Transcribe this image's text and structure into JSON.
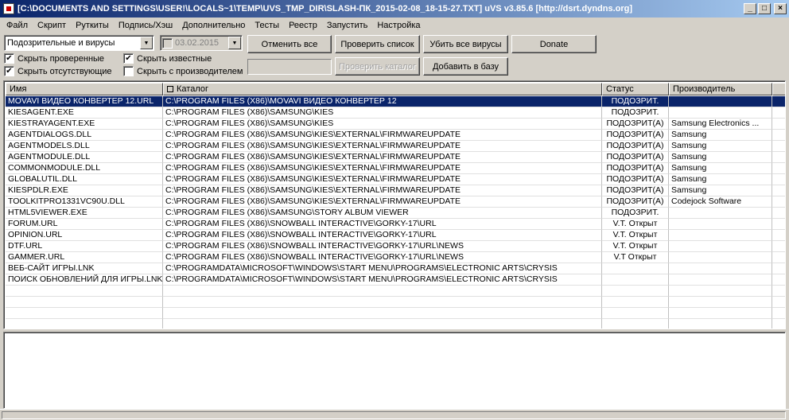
{
  "window": {
    "title": "[C:\\DOCUMENTS AND SETTINGS\\USER!\\LOCALS~1\\TEMP\\UVS_TMP_DIR\\SLASH-ПК_2015-02-08_18-15-27.TXT] uVS v3.85.6 [http://dsrt.dyndns.org]",
    "minimize": "_",
    "maximize": "□",
    "close": "×"
  },
  "menu": [
    "Файл",
    "Скрипт",
    "Руткиты",
    "Подпись/Хэш",
    "Дополнительно",
    "Тесты",
    "Реестр",
    "Запустить",
    "Настройка"
  ],
  "filter": {
    "selected": "Подозрительные и вирусы",
    "date": "03.02.2015"
  },
  "checks": {
    "hide_checked": {
      "label": "Скрыть проверенные",
      "checked": true
    },
    "hide_known": {
      "label": "Скрыть известные",
      "checked": true
    },
    "hide_missing": {
      "label": "Скрыть отсутствующие",
      "checked": true
    },
    "hide_with_vendor": {
      "label": "Скрыть с производителем",
      "checked": false
    }
  },
  "buttons": {
    "cancel_all": "Отменить все",
    "check_list": "Проверить список",
    "kill_all": "Убить все вирусы",
    "donate": "Donate",
    "check_dir": "Проверить каталог",
    "add_to_db": "Добавить в базу"
  },
  "columns": {
    "name": "Имя",
    "dir": "Каталог",
    "status": "Статус",
    "vendor": "Производитель"
  },
  "rows": [
    {
      "name": "MOVAVI ВИДЕО КОНВЕРТЕР 12.URL",
      "dir": "C:\\PROGRAM FILES (X86)\\MOVAVI ВИДЕО КОНВЕРТЕР 12",
      "status": "ПОДОЗРИТ.",
      "vendor": ""
    },
    {
      "name": "KIESAGENT.EXE",
      "dir": "C:\\PROGRAM FILES (X86)\\SAMSUNG\\KIES",
      "status": "ПОДОЗРИТ.",
      "vendor": ""
    },
    {
      "name": "KIESTRAYAGENT.EXE",
      "dir": "C:\\PROGRAM FILES (X86)\\SAMSUNG\\KIES",
      "status": "ПОДОЗРИТ(А)",
      "vendor": "Samsung Electronics ..."
    },
    {
      "name": "AGENTDIALOGS.DLL",
      "dir": "C:\\PROGRAM FILES (X86)\\SAMSUNG\\KIES\\EXTERNAL\\FIRMWAREUPDATE",
      "status": "ПОДОЗРИТ(А)",
      "vendor": "Samsung"
    },
    {
      "name": "AGENTMODELS.DLL",
      "dir": "C:\\PROGRAM FILES (X86)\\SAMSUNG\\KIES\\EXTERNAL\\FIRMWAREUPDATE",
      "status": "ПОДОЗРИТ(А)",
      "vendor": "Samsung"
    },
    {
      "name": "AGENTMODULE.DLL",
      "dir": "C:\\PROGRAM FILES (X86)\\SAMSUNG\\KIES\\EXTERNAL\\FIRMWAREUPDATE",
      "status": "ПОДОЗРИТ(А)",
      "vendor": "Samsung"
    },
    {
      "name": "COMMONMODULE.DLL",
      "dir": "C:\\PROGRAM FILES (X86)\\SAMSUNG\\KIES\\EXTERNAL\\FIRMWAREUPDATE",
      "status": "ПОДОЗРИТ(А)",
      "vendor": "Samsung"
    },
    {
      "name": "GLOBALUTIL.DLL",
      "dir": "C:\\PROGRAM FILES (X86)\\SAMSUNG\\KIES\\EXTERNAL\\FIRMWAREUPDATE",
      "status": "ПОДОЗРИТ(А)",
      "vendor": "Samsung"
    },
    {
      "name": "KIESPDLR.EXE",
      "dir": "C:\\PROGRAM FILES (X86)\\SAMSUNG\\KIES\\EXTERNAL\\FIRMWAREUPDATE",
      "status": "ПОДОЗРИТ(А)",
      "vendor": "Samsung"
    },
    {
      "name": "TOOLKITPRO1331VC90U.DLL",
      "dir": "C:\\PROGRAM FILES (X86)\\SAMSUNG\\KIES\\EXTERNAL\\FIRMWAREUPDATE",
      "status": "ПОДОЗРИТ(А)",
      "vendor": "Codejock Software"
    },
    {
      "name": "HTML5VIEWER.EXE",
      "dir": "C:\\PROGRAM FILES (X86)\\SAMSUNG\\STORY ALBUM VIEWER",
      "status": "ПОДОЗРИТ.",
      "vendor": ""
    },
    {
      "name": "FORUM.URL",
      "dir": "C:\\PROGRAM FILES (X86)\\SNOWBALL INTERACTIVE\\GORKY-17\\URL",
      "status": "V.T. Открыт",
      "vendor": ""
    },
    {
      "name": "OPINION.URL",
      "dir": "C:\\PROGRAM FILES (X86)\\SNOWBALL INTERACTIVE\\GORKY-17\\URL",
      "status": "V.T. Открыт",
      "vendor": ""
    },
    {
      "name": "DTF.URL",
      "dir": "C:\\PROGRAM FILES (X86)\\SNOWBALL INTERACTIVE\\GORKY-17\\URL\\NEWS",
      "status": "V.T. Открыт",
      "vendor": ""
    },
    {
      "name": "GAMMER.URL",
      "dir": "C:\\PROGRAM FILES (X86)\\SNOWBALL INTERACTIVE\\GORKY-17\\URL\\NEWS",
      "status": "V.T  Открыт",
      "vendor": ""
    },
    {
      "name": "ВЕБ-САЙТ ИГРЫ.LNK",
      "dir": "C:\\PROGRAMDATA\\MICROSOFT\\WINDOWS\\START MENU\\PROGRAMS\\ELECTRONIC ARTS\\CRYSIS",
      "status": "",
      "vendor": ""
    },
    {
      "name": "ПОИСК ОБНОВЛЕНИЙ ДЛЯ ИГРЫ.LNK",
      "dir": "C:\\PROGRAMDATA\\MICROSOFT\\WINDOWS\\START MENU\\PROGRAMS\\ELECTRONIC ARTS\\CRYSIS",
      "status": "",
      "vendor": ""
    }
  ],
  "selected_row": 0
}
